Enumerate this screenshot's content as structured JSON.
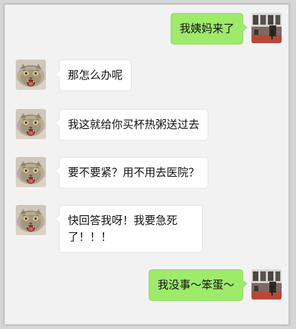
{
  "colors": {
    "outgoing_bubble": "#9eea6a",
    "incoming_bubble": "#ffffff",
    "background": "#f2f2f2"
  },
  "icons": {
    "self_avatar": "room-photo-avatar",
    "contact_avatar": "cat-avatar"
  },
  "messages": [
    {
      "sender": "self",
      "text": "我姨妈来了"
    },
    {
      "sender": "contact",
      "text": "那怎么办呢"
    },
    {
      "sender": "contact",
      "text": "我这就给你买杯热粥送过去"
    },
    {
      "sender": "contact",
      "text": "要不要紧？用不用去医院？"
    },
    {
      "sender": "contact",
      "text": "快回答我呀！我要急死了！！！"
    },
    {
      "sender": "self",
      "text": "我没事～笨蛋～"
    }
  ]
}
